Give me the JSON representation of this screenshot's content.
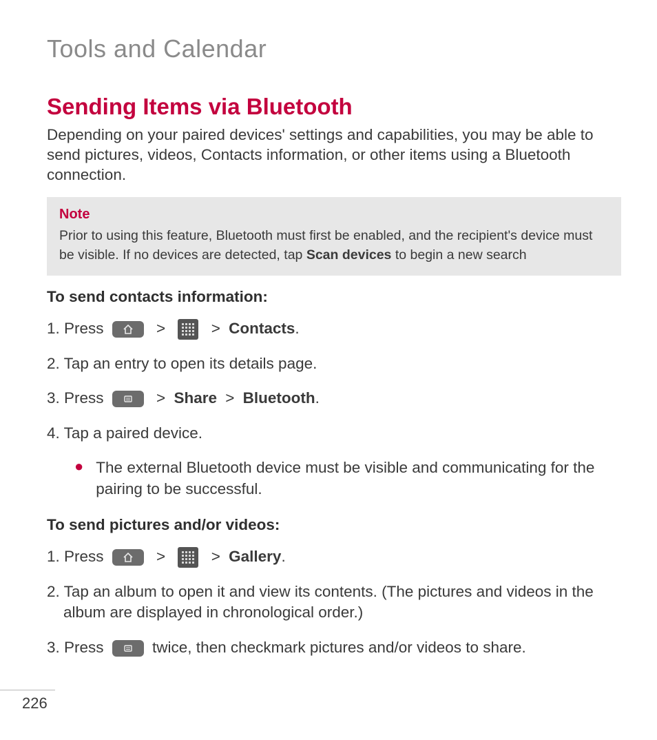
{
  "chapter": "Tools and Calendar",
  "section_title": "Sending Items via Bluetooth",
  "intro": "Depending on your paired devices' settings and capabilities, you may be able to send pictures, videos, Contacts information, or other items using a Bluetooth connection.",
  "note": {
    "label": "Note",
    "text_before": "Prior to using this feature, Bluetooth must first be enabled, and the recipient's device must be visible. If no devices are detected, tap ",
    "bold": "Scan devices",
    "text_after": " to begin a new search"
  },
  "contacts": {
    "heading": "To send contacts information:",
    "step1_prefix": "1. Press ",
    "step1_target": "Contacts",
    "step1_suffix": ".",
    "step2": "2. Tap an entry to open its details page.",
    "step3_prefix": "3. Press ",
    "step3_share": "Share",
    "step3_bt": "Bluetooth",
    "step3_suffix": ".",
    "step4": "4. Tap a paired device.",
    "bullet": "The external Bluetooth device must be visible and communicating for the pairing to be successful."
  },
  "pictures": {
    "heading": "To send pictures and/or videos:",
    "step1_prefix": "1. Press ",
    "step1_target": "Gallery",
    "step1_suffix": ".",
    "step2": "2. Tap an album to open it and view its contents. (The pictures and videos in the album are displayed in chronological order.)",
    "step3_prefix": "3. Press ",
    "step3_suffix": " twice, then checkmark pictures and/or videos to share."
  },
  "gt": ">",
  "page_number": "226"
}
